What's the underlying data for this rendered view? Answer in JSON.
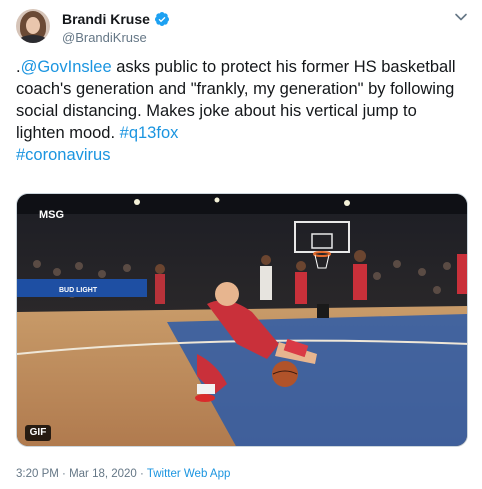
{
  "author": {
    "display_name": "Brandi Kruse",
    "handle": "@BrandiKruse",
    "verified": true
  },
  "tweet": {
    "text_intro": ".",
    "mention": "@GovInslee",
    "text_body": " asks public to protect his former HS basketball coach's generation and \"frankly, my generation\" by following social distancing. Makes joke about his vertical jump to lighten mood. ",
    "hashtag_1": "#q13fox",
    "hashtag_2": "#coronavirus"
  },
  "media": {
    "badge": "GIF",
    "broadcaster_logo": "MSG",
    "court_sign": "BUD LIGHT"
  },
  "meta": {
    "time": "3:20 PM",
    "separator_1": " · ",
    "date": "Mar 18, 2020",
    "separator_2": " · ",
    "source": "Twitter Web App"
  },
  "colors": {
    "link": "#1b95e0",
    "verified_badge": "#1da1f2",
    "secondary_text": "#657786"
  },
  "icons": [
    "verified-badge-icon",
    "chevron-down-icon"
  ]
}
